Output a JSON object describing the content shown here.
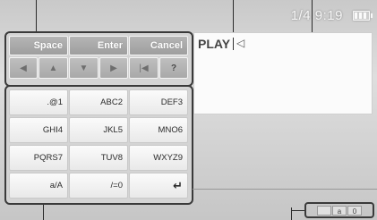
{
  "status": {
    "clock": "1/4 9:19",
    "battery_icon": "battery-icon"
  },
  "keyboard": {
    "function_keys": [
      "Space",
      "Enter",
      "Cancel"
    ],
    "nav_keys": [
      {
        "icon": "arrow-left-icon",
        "label": "◀"
      },
      {
        "icon": "arrow-up-icon",
        "label": "▲"
      },
      {
        "icon": "arrow-down-icon",
        "label": "▼"
      },
      {
        "icon": "arrow-right-icon",
        "label": "▶"
      },
      {
        "icon": "jump-to-start-icon",
        "label": "|◀"
      },
      {
        "icon": "help-icon",
        "label": "?"
      }
    ],
    "char_keys": [
      ".@1",
      "ABC2",
      "DEF3",
      "GHI4",
      "JKL5",
      "MNO6",
      "PQRS7",
      "TUV8",
      "WXYZ9",
      "a/A",
      "/=0",
      "↵"
    ]
  },
  "text_field": {
    "value": "PLAY",
    "cursor_marker": "◁"
  },
  "input_mode": {
    "cells": [
      "",
      "a",
      "0"
    ]
  }
}
